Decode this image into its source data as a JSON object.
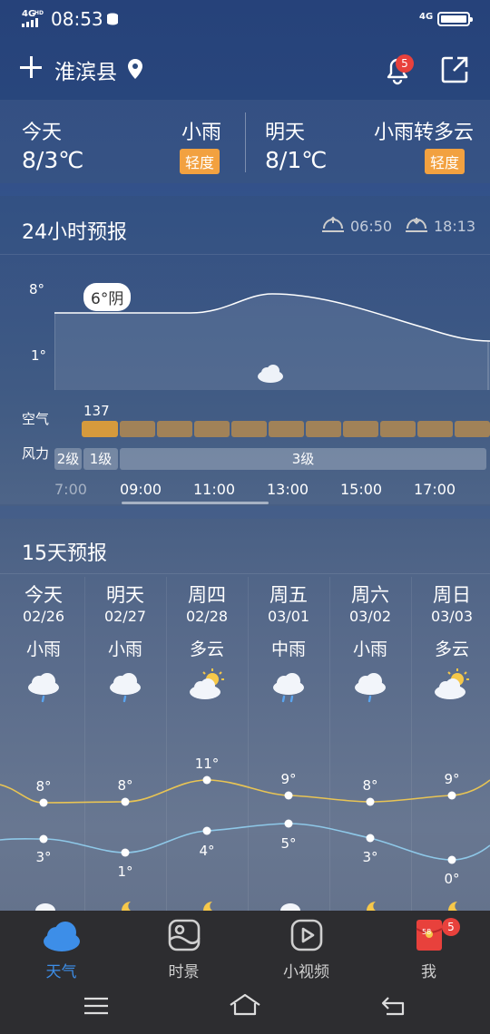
{
  "status_bar": {
    "network_left": "4G",
    "hd_label": "HD",
    "time": "08:53",
    "network_right": "4G"
  },
  "header": {
    "city": "淮滨县",
    "notification_count": "5"
  },
  "today": {
    "label": "今天",
    "temp": "8/3℃",
    "weather": "小雨",
    "air_quality": "轻度"
  },
  "tomorrow": {
    "label": "明天",
    "temp": "8/1℃",
    "weather": "小雨转多云",
    "air_quality": "轻度"
  },
  "hourly": {
    "title": "24小时预报",
    "sunrise": "06:50",
    "sunset": "18:13",
    "y_high": "8°",
    "y_low": "1°",
    "bubble": "6°阴",
    "air_label": "空气",
    "air_value": "137",
    "wind_label": "风力",
    "wind_levels": [
      "2级",
      "1级",
      "3级"
    ],
    "times": [
      "7:00",
      "09:00",
      "11:00",
      "13:00",
      "15:00",
      "17:00"
    ]
  },
  "daily": {
    "title": "15天预报",
    "days": [
      {
        "name": "今天",
        "date": "02/26",
        "weather": "小雨",
        "icon": "rain-cloud-icon",
        "high": "8°",
        "low": "3°"
      },
      {
        "name": "明天",
        "date": "02/27",
        "weather": "小雨",
        "icon": "rain-cloud-icon",
        "high": "8°",
        "low": "1°"
      },
      {
        "name": "周四",
        "date": "02/28",
        "weather": "多云",
        "icon": "partly-cloudy-icon",
        "high": "11°",
        "low": "4°"
      },
      {
        "name": "周五",
        "date": "03/01",
        "weather": "中雨",
        "icon": "rain-cloud-icon",
        "high": "9°",
        "low": "5°"
      },
      {
        "name": "周六",
        "date": "03/02",
        "weather": "小雨",
        "icon": "rain-cloud-icon",
        "high": "8°",
        "low": "3°"
      },
      {
        "name": "周日",
        "date": "03/03",
        "weather": "多云",
        "icon": "partly-cloudy-icon",
        "high": "9°",
        "low": "0°"
      }
    ]
  },
  "nav": {
    "tabs": [
      {
        "label": "天气",
        "active": true
      },
      {
        "label": "时景",
        "active": false
      },
      {
        "label": "小视频",
        "active": false
      },
      {
        "label": "我",
        "active": false,
        "badge": "5",
        "packet_text": "58"
      }
    ]
  },
  "colors": {
    "accent": "#3d8ee8",
    "badge": "#e8413c",
    "aq_mild": "#f2a140",
    "high_line": "#e8c454",
    "low_line": "#8ec8e8"
  }
}
